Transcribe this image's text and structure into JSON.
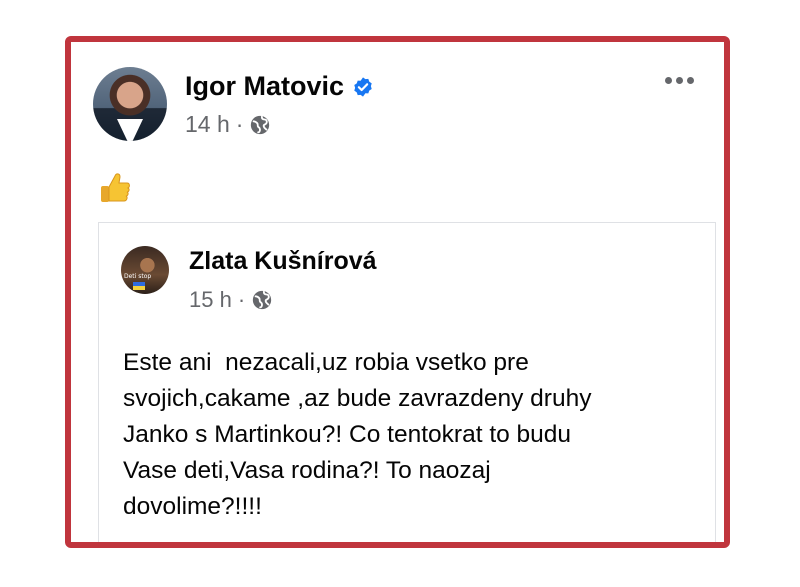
{
  "post": {
    "author": "Igor Matovic",
    "verified": true,
    "time": "14 h",
    "separator": "·",
    "audience_icon": "globe-icon",
    "more_icon": "more-options-icon",
    "reaction_icon": "thumbs-up-emoji"
  },
  "shared_post": {
    "author": "Zlata Kušnírová",
    "avatar_caption": "Deti stop",
    "time": "15 h",
    "separator": "·",
    "audience_icon": "globe-icon",
    "text": "Este ani  nezacali,uz robia vsetko pre\nsvojich,cakame ,az bude zavrazdeny druhy\nJanko s Martinkou?! Co tentokrat to budu\nVase deti,Vasa rodina?! To naozaj\ndovolime?!!!!"
  },
  "colors": {
    "frame_border": "#c0353d",
    "verified_badge": "#1877f2",
    "meta_gray": "#65676b",
    "text": "#050505"
  }
}
